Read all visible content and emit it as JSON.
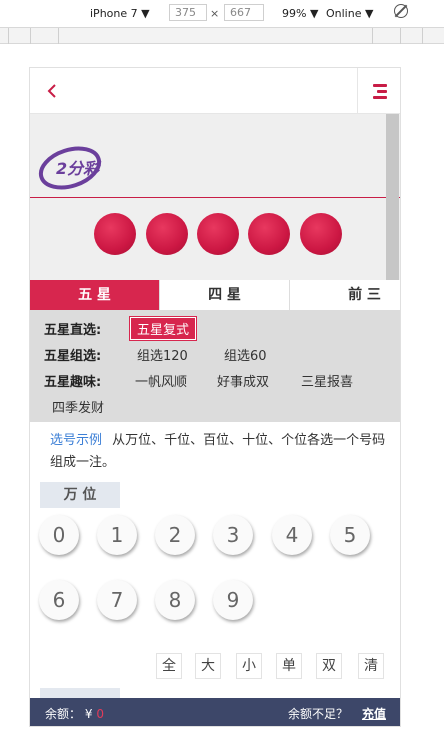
{
  "devtools": {
    "device": "iPhone 7 ▼",
    "width": "375",
    "times": "×",
    "height": "667",
    "zoom": "99% ▼",
    "network": "Online ▼"
  },
  "header": {
    "back_icon": "chevron-left-icon",
    "menu_icon": "hamburger-icon"
  },
  "logo": {
    "text": "2分彩"
  },
  "tabs": [
    {
      "label": "五 星",
      "active": true
    },
    {
      "label": "四 星",
      "active": false
    },
    {
      "label": "前 三",
      "active": false
    }
  ],
  "modes": {
    "direct": {
      "label": "五星直选:",
      "options": [
        "五星复式"
      ]
    },
    "group": {
      "label": "五星组选:",
      "options": [
        "组选120",
        "组选60"
      ]
    },
    "fun": {
      "label": "五星趣味:",
      "options": [
        "一帆风顺",
        "好事成双",
        "三星报喜",
        "四季发财"
      ]
    }
  },
  "hint": {
    "link": "选号示例",
    "text": "从万位、千位、百位、十位、个位各选一个号码组成一注。"
  },
  "position": {
    "label": "万 位"
  },
  "digits": [
    "0",
    "1",
    "2",
    "3",
    "4",
    "5",
    "6",
    "7",
    "8",
    "9"
  ],
  "quick": [
    "全",
    "大",
    "小",
    "单",
    "双",
    "清"
  ],
  "footer": {
    "balance_label": "余额：",
    "currency": "¥",
    "amount": "0",
    "tip": "余额不足？",
    "recharge": "充值"
  },
  "colors": {
    "accent": "#d7264e",
    "footer": "#3d4769",
    "link": "#3c7fd6"
  }
}
